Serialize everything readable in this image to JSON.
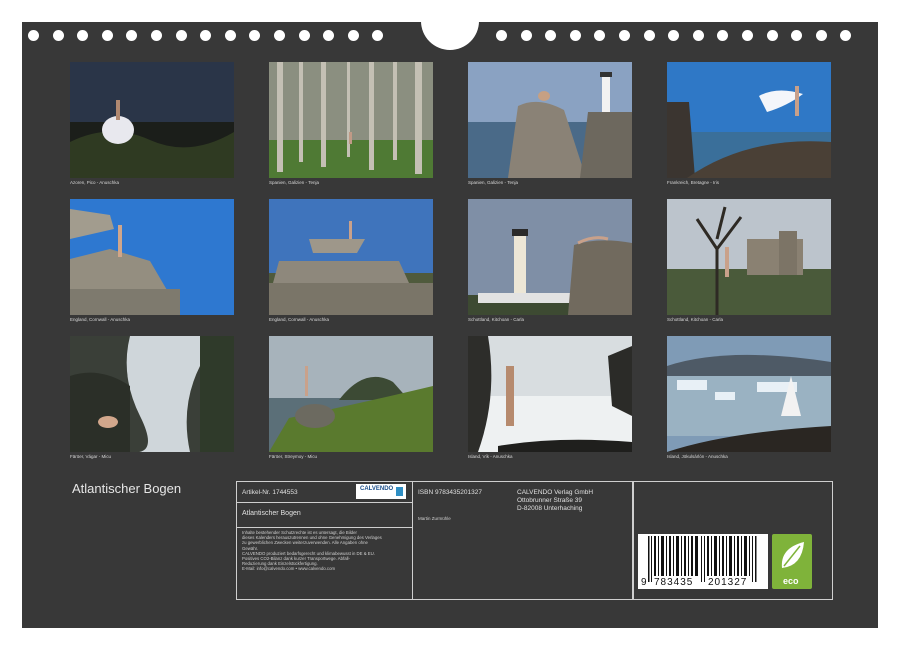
{
  "calendar": {
    "title": "Atlantischer Bogen",
    "photos": [
      {
        "caption": "Azoren, Pico - Anuschka"
      },
      {
        "caption": "Spanien, Galizien - Tenja"
      },
      {
        "caption": "Spanien, Galizien - Tenja"
      },
      {
        "caption": "Frankreich, Bretagne - Iris"
      },
      {
        "caption": "England, Cornwall - Anuschka"
      },
      {
        "caption": "England, Cornwall - Anuschka"
      },
      {
        "caption": "Schottland, Kitchoan - Carla"
      },
      {
        "caption": "Schottland, Kitchoan - Carla"
      },
      {
        "caption": "Färöer, Vágar - Micu"
      },
      {
        "caption": "Färöer, Streymoy - Micu"
      },
      {
        "caption": "Island, Vík - Anuschka"
      },
      {
        "caption": "Island, Jökulsárlón - Anuschka"
      }
    ]
  },
  "info": {
    "article_label": "Artikel-Nr. 1744553",
    "brand_logo": "CALVENDO",
    "product_title": "Atlantischer Bogen",
    "isbn_label": "ISBN 9783435201327",
    "publisher_name": "CALVENDO Verlag GmbH",
    "publisher_street": "Ottobrunner Straße 39",
    "publisher_city": "D-82008 Unterhaching",
    "author": "Martin Zurmühle",
    "legal_lines": [
      "Inhalte bestehender Schutzrechte ist es untersagt, die Bilder",
      "dieses Kalenders herauszutrennen und ohne Genehmigung des Verlages",
      "zu gewerblichen Zwecken weiterzuverwenden. Alle Angaben ohne",
      "Gewähr.",
      "CALVENDO produziert bedarfsgerecht und klimabewusst in DE & EU.",
      "Positives CO2-Bilanz dank kurzer Transportwege. Abfall-",
      "Reduzierung dank Einzelstückfertigung.",
      "E-Mail: info@calvendo.com • www.calvendo.com"
    ]
  },
  "barcode": {
    "digits_first": "9",
    "digits_group1": "783435",
    "digits_group2": "201327",
    "eco_label": "eco"
  },
  "colors": {
    "background": "#383838",
    "eco_green": "#7fb33a"
  }
}
